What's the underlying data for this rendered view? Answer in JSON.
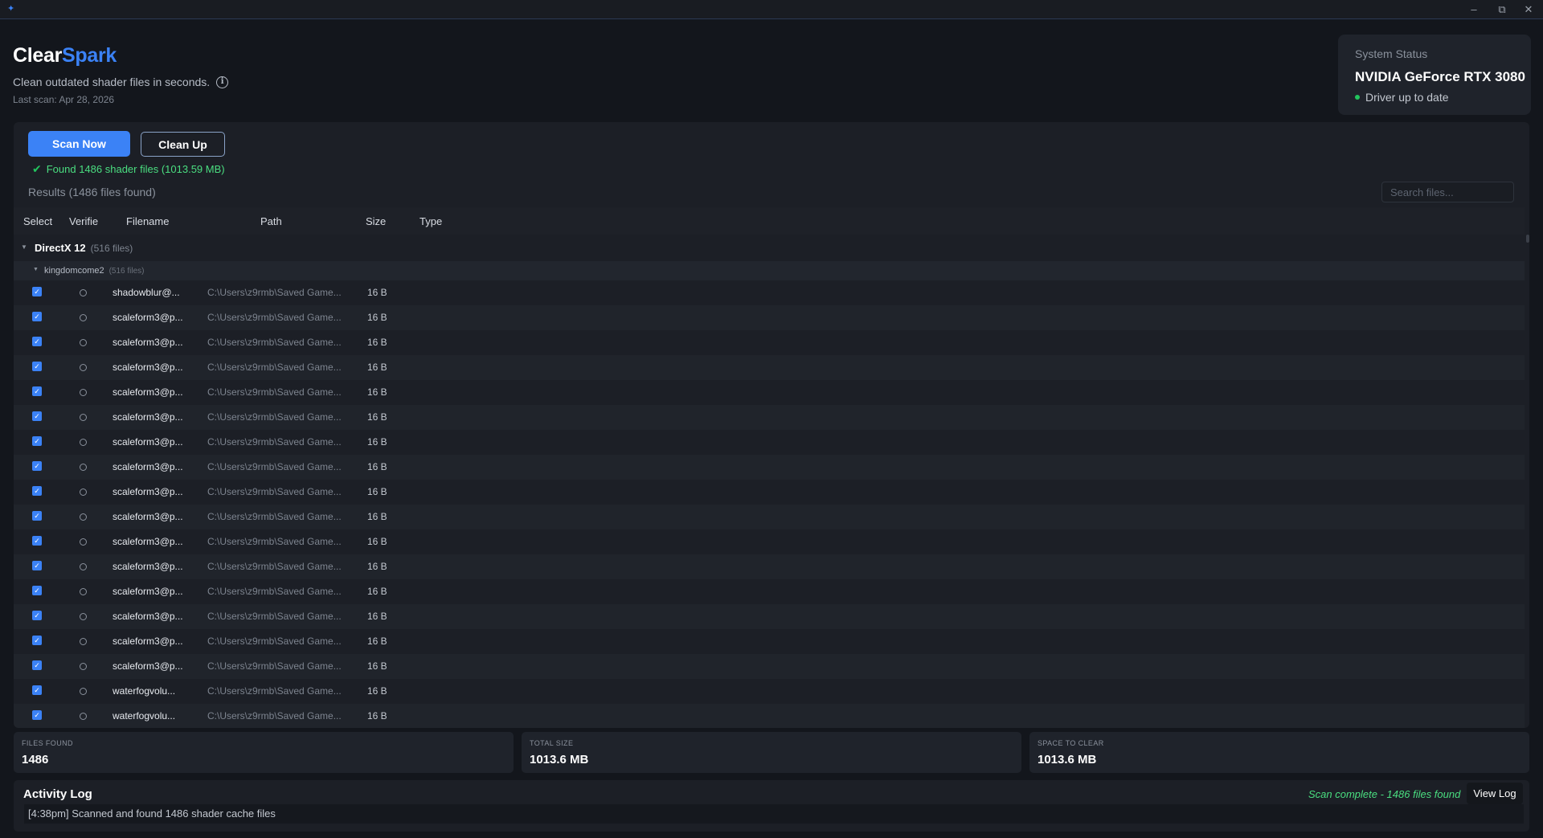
{
  "window": {
    "minimize": "–",
    "restore": "⧉",
    "close": "✕"
  },
  "header": {
    "brand_part1": "Clear",
    "brand_part2": "Spark",
    "tagline": "Clean outdated shader files in seconds.",
    "last_scan": "Last scan: Apr 28, 2026"
  },
  "system_status": {
    "title": "System Status",
    "gpu": "NVIDIA GeForce RTX 3080",
    "driver": "Driver up to date"
  },
  "toolbar": {
    "scan_label": "Scan Now",
    "clean_label": "Clean Up",
    "found_message": "Found 1486 shader files (1013.59 MB)",
    "results_label": "Results (1486 files found)",
    "search_placeholder": "Search files..."
  },
  "table": {
    "columns": [
      "Select",
      "Verifie",
      "Filename",
      "Path",
      "Size",
      "Type"
    ],
    "group": {
      "name": "DirectX 12",
      "count": "(516 files)"
    },
    "subgroup": {
      "name": "kingdomcome2",
      "count": "(516 files)"
    },
    "rows": [
      {
        "filename": "shadowblur@...",
        "path": "C:\\Users\\z9rmb\\Saved Game...",
        "size": "16 B"
      },
      {
        "filename": "scaleform3@p...",
        "path": "C:\\Users\\z9rmb\\Saved Game...",
        "size": "16 B"
      },
      {
        "filename": "scaleform3@p...",
        "path": "C:\\Users\\z9rmb\\Saved Game...",
        "size": "16 B"
      },
      {
        "filename": "scaleform3@p...",
        "path": "C:\\Users\\z9rmb\\Saved Game...",
        "size": "16 B"
      },
      {
        "filename": "scaleform3@p...",
        "path": "C:\\Users\\z9rmb\\Saved Game...",
        "size": "16 B"
      },
      {
        "filename": "scaleform3@p...",
        "path": "C:\\Users\\z9rmb\\Saved Game...",
        "size": "16 B"
      },
      {
        "filename": "scaleform3@p...",
        "path": "C:\\Users\\z9rmb\\Saved Game...",
        "size": "16 B"
      },
      {
        "filename": "scaleform3@p...",
        "path": "C:\\Users\\z9rmb\\Saved Game...",
        "size": "16 B"
      },
      {
        "filename": "scaleform3@p...",
        "path": "C:\\Users\\z9rmb\\Saved Game...",
        "size": "16 B"
      },
      {
        "filename": "scaleform3@p...",
        "path": "C:\\Users\\z9rmb\\Saved Game...",
        "size": "16 B"
      },
      {
        "filename": "scaleform3@p...",
        "path": "C:\\Users\\z9rmb\\Saved Game...",
        "size": "16 B"
      },
      {
        "filename": "scaleform3@p...",
        "path": "C:\\Users\\z9rmb\\Saved Game...",
        "size": "16 B"
      },
      {
        "filename": "scaleform3@p...",
        "path": "C:\\Users\\z9rmb\\Saved Game...",
        "size": "16 B"
      },
      {
        "filename": "scaleform3@p...",
        "path": "C:\\Users\\z9rmb\\Saved Game...",
        "size": "16 B"
      },
      {
        "filename": "scaleform3@p...",
        "path": "C:\\Users\\z9rmb\\Saved Game...",
        "size": "16 B"
      },
      {
        "filename": "scaleform3@p...",
        "path": "C:\\Users\\z9rmb\\Saved Game...",
        "size": "16 B"
      },
      {
        "filename": "waterfogvolu...",
        "path": "C:\\Users\\z9rmb\\Saved Game...",
        "size": "16 B"
      },
      {
        "filename": "waterfogvolu...",
        "path": "C:\\Users\\z9rmb\\Saved Game...",
        "size": "16 B"
      }
    ]
  },
  "stats": [
    {
      "label": "FILES FOUND",
      "value": "1486"
    },
    {
      "label": "TOTAL SIZE",
      "value": "1013.6 MB"
    },
    {
      "label": "SPACE TO CLEAR",
      "value": "1013.6 MB"
    }
  ],
  "activity_log": {
    "title": "Activity Log",
    "status": "Scan complete - 1486 files found",
    "view_log_label": "View Log",
    "entries": [
      "[4:38pm] Scanned and found 1486 shader cache files"
    ]
  },
  "colors": {
    "accent": "#3b82f6",
    "success": "#4ade80",
    "background": "#13161c",
    "panel": "#1c1f26"
  },
  "icons": [
    "app-icon",
    "info-icon",
    "check-icon",
    "chevron-down-icon",
    "status-dot-icon"
  ]
}
